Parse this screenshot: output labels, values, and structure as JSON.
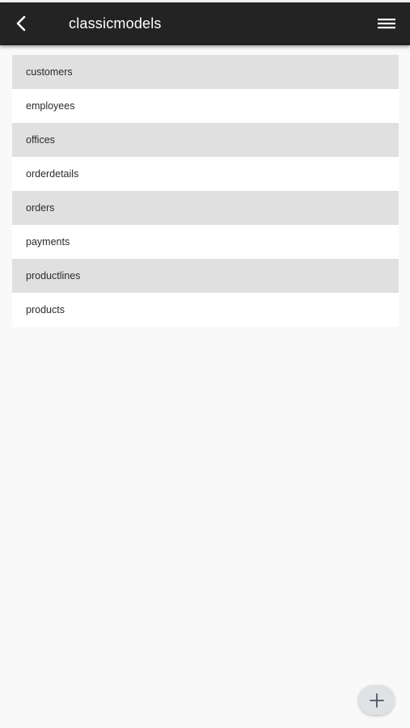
{
  "app_bar": {
    "title": "classicmodels",
    "back_icon": "chevron-left-icon",
    "menu_icon": "hamburger-menu-icon",
    "background_color": "#232323"
  },
  "tables": [
    {
      "label": "customers"
    },
    {
      "label": "employees"
    },
    {
      "label": "offices"
    },
    {
      "label": "orderdetails"
    },
    {
      "label": "orders"
    },
    {
      "label": "payments"
    },
    {
      "label": "productlines"
    },
    {
      "label": "products"
    }
  ],
  "fab": {
    "icon": "plus-icon"
  },
  "colors": {
    "row_alt": "#e0e0e0",
    "row": "#ffffff",
    "page_background": "#f9f9f9"
  }
}
